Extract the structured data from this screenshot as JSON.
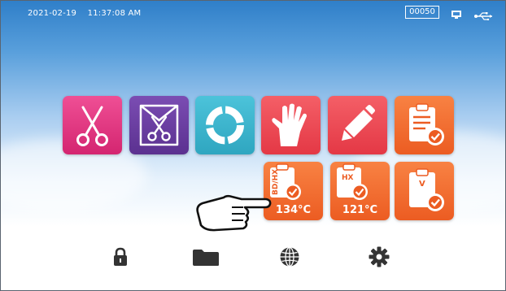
{
  "status_bar": {
    "datetime": "2021-02-19    11:37:08 AM",
    "counter": "00050",
    "icons": [
      "monitor-icon",
      "usb-icon"
    ]
  },
  "programs_row1": [
    {
      "name": "program-instruments",
      "icon": "scissors-icon",
      "color": "#e2347f"
    },
    {
      "name": "program-wrapped-instruments",
      "icon": "wrapped-scissors-icon",
      "color": "#6a3fa0"
    },
    {
      "name": "program-rubber-tubing",
      "icon": "ring-icon",
      "color": "#3fb3cc"
    },
    {
      "name": "program-gloves",
      "icon": "glove-icon",
      "color": "#ec4654"
    },
    {
      "name": "program-custom",
      "icon": "pencil-icon",
      "color": "#ec4654"
    },
    {
      "name": "program-test",
      "icon": "clipboard-check-icon",
      "color": "#f0692a"
    }
  ],
  "programs_row2": [
    {
      "name": "test-bdhx",
      "icon": "clipboard-check-icon",
      "tag": "BD/HX",
      "temp": "134°C",
      "color": "#f0692a"
    },
    {
      "name": "test-hx",
      "icon": "clipboard-check-icon",
      "tag": "HX",
      "temp": "121°C",
      "color": "#f0692a"
    },
    {
      "name": "test-vacuum",
      "icon": "clipboard-check-icon",
      "tag": "V",
      "color": "#f0692a"
    }
  ],
  "bottom_bar": [
    "lock-icon",
    "folder-icon",
    "globe-icon",
    "gear-icon"
  ],
  "pointer": "pointing-hand-icon"
}
